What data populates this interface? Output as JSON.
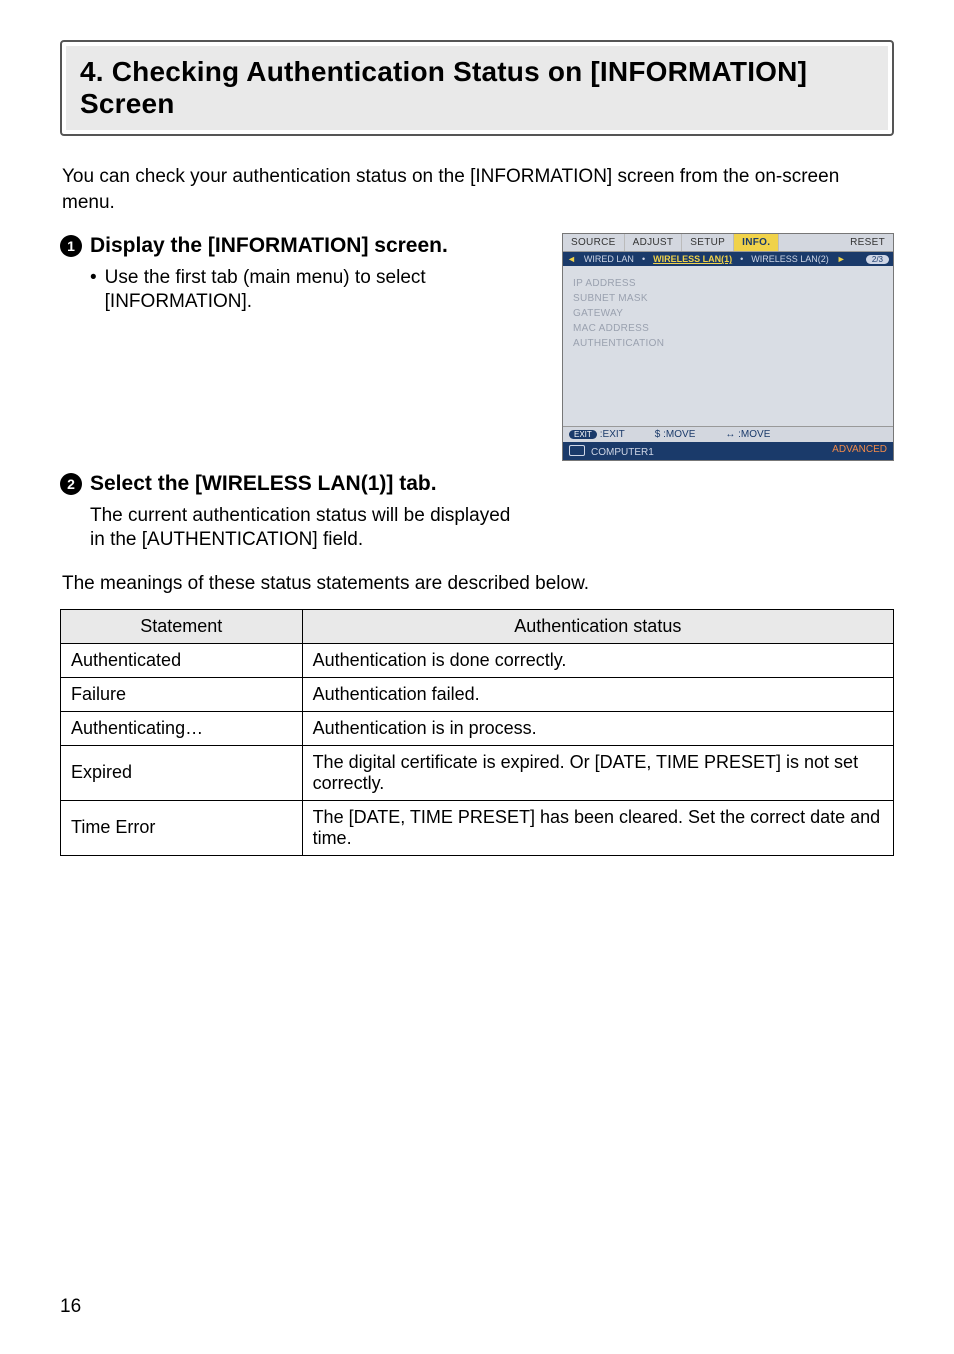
{
  "title": "4. Checking Authentication Status on [INFORMATION] Screen",
  "intro": "You can check your authentication status on the [INFORMATION] screen from the on-screen menu.",
  "step1": {
    "num": "1",
    "title": "Display the [INFORMATION] screen.",
    "bullet": "Use the first tab (main menu) to select [INFORMATION]."
  },
  "step2": {
    "num": "2",
    "title": "Select the [WIRELESS LAN(1)] tab.",
    "desc": "The current authentication status will be displayed in the [AUTHENTICATION] field."
  },
  "meanings": "The meanings of these status statements are described below.",
  "table": {
    "headers": {
      "statement": "Statement",
      "status": "Authentication status"
    },
    "rows": [
      {
        "s": "Authenticated",
        "d": "Authentication is done correctly."
      },
      {
        "s": "Failure",
        "d": "Authentication failed."
      },
      {
        "s": "Authenticating…",
        "d": "Authentication is in process."
      },
      {
        "s": "Expired",
        "d": "The digital certificate is expired. Or [DATE, TIME PRESET] is not set correctly."
      },
      {
        "s": "Time Error",
        "d": "The [DATE, TIME PRESET] has been cleared. Set the correct date and time."
      }
    ]
  },
  "osd": {
    "tabs": {
      "source": "SOURCE",
      "adjust": "ADJUST",
      "setup": "SETUP",
      "info": "INFO.",
      "reset": "RESET"
    },
    "subtabs": {
      "wired": "WIRED LAN",
      "w1": "WIRELESS LAN(1)",
      "w2": "WIRELESS LAN(2)",
      "page": "2/3"
    },
    "fields": {
      "ip": "IP ADDRESS",
      "mask": "SUBNET MASK",
      "gw": "GATEWAY",
      "mac": "MAC ADDRESS",
      "auth": "AUTHENTICATION"
    },
    "footer1": {
      "exit_badge": "EXIT",
      "exit": ":EXIT",
      "move1": "$ :MOVE",
      "move2": "↔ :MOVE"
    },
    "footer2": {
      "src": "COMPUTER1",
      "adv": "ADVANCED"
    }
  },
  "page_number": "16"
}
